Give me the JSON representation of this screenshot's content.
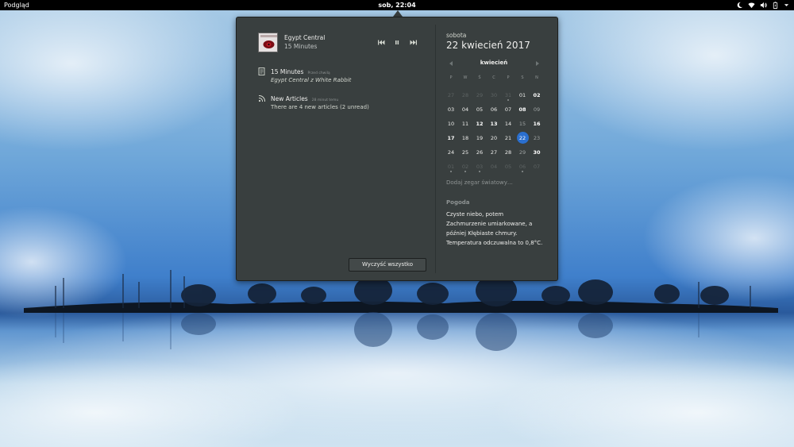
{
  "topbar": {
    "activities": "Podgląd",
    "clock": "sob, 22:04",
    "tray_icons": [
      "night-light-icon",
      "wifi-icon",
      "volume-icon",
      "battery-icon",
      "system-menu-arrow-icon"
    ]
  },
  "notifications": {
    "player": {
      "title": "Egypt Central",
      "subtitle": "15 Minutes",
      "controls": [
        "previous-track-icon",
        "pause-icon",
        "next-track-icon"
      ]
    },
    "items": [
      {
        "icon": "document-icon",
        "title": "15 Minutes",
        "time": "Przed chwilą",
        "body": "Egypt Central z White Rabbit"
      },
      {
        "icon": "rss-feed-icon",
        "title": "New Articles",
        "time": "28 minut temu",
        "body": "There are 4 new articles (2 unread)"
      }
    ],
    "clear_label": "Wyczyść wszystko"
  },
  "calendar": {
    "weekday": "sobota",
    "date": "22 kwiecień 2017",
    "month": "kwiecień",
    "weekday_headers": [
      "P",
      "W",
      "Ś",
      "C",
      "P",
      "S",
      "N"
    ],
    "weeks": [
      [
        "27",
        "28",
        "29",
        "30",
        "31",
        "01",
        "02"
      ],
      [
        "03",
        "04",
        "05",
        "06",
        "07",
        "08",
        "09"
      ],
      [
        "10",
        "11",
        "12",
        "13",
        "14",
        "15",
        "16"
      ],
      [
        "17",
        "18",
        "19",
        "20",
        "21",
        "22",
        "23"
      ],
      [
        "24",
        "25",
        "26",
        "27",
        "28",
        "29",
        "30"
      ],
      [
        "01",
        "02",
        "03",
        "04",
        "05",
        "06",
        "07"
      ]
    ],
    "world_clock": "Dodaj zegar światowy…",
    "weather_heading": "Pogoda",
    "weather_text": "Czyste niebo, potem Zachmurzenie umiarkowane, a później Kłębiaste chmury. Temperatura odczuwalna to 0,8°C."
  },
  "colors": {
    "panel": "#393f3f",
    "accent": "#2a6fcf",
    "topbar": "#000000"
  }
}
